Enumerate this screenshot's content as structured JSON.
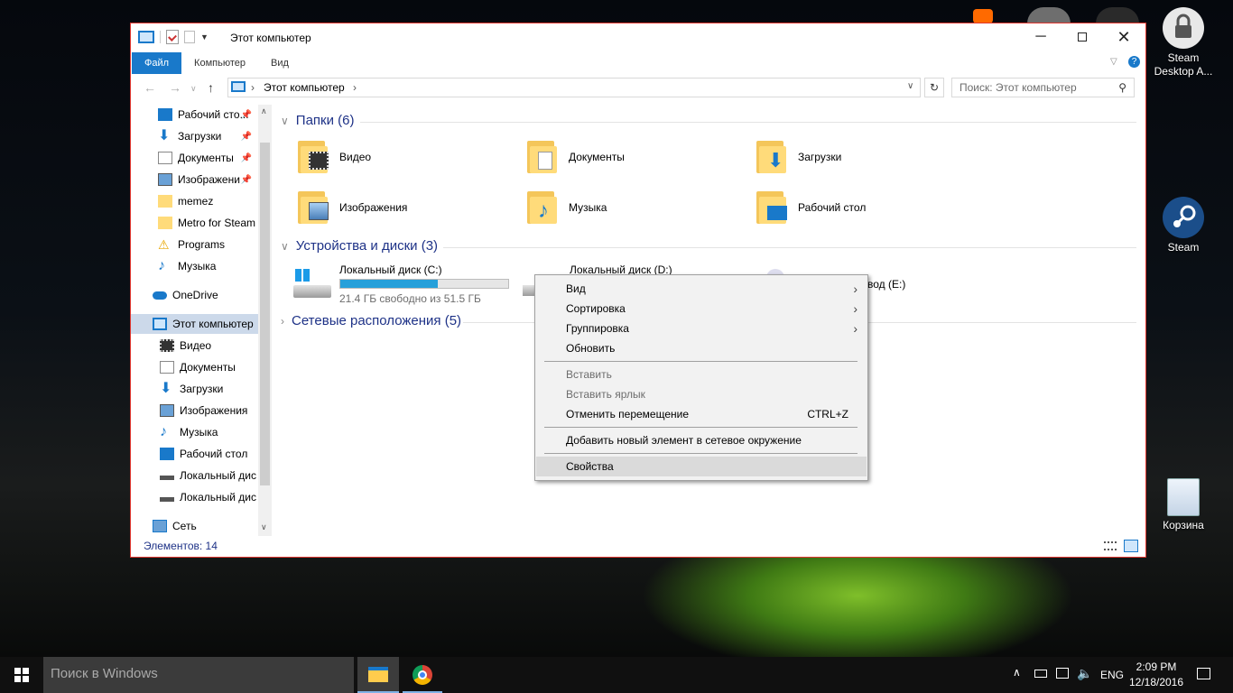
{
  "desktop": {
    "icons": [
      {
        "label": "Steam Desktop A...",
        "icon": "steam-desktop-auth-icon"
      },
      {
        "label": "Steam",
        "icon": "steam-icon"
      },
      {
        "label": "Корзина",
        "icon": "recycle-bin-icon"
      }
    ]
  },
  "window": {
    "title": "Этот компьютер",
    "tabs": [
      "Файл",
      "Компьютер",
      "Вид"
    ],
    "address": "Этот компьютер",
    "search_placeholder": "Поиск: Этот компьютер",
    "status": "Элементов: 14"
  },
  "sidebar": {
    "items": [
      {
        "label": "Рабочий сто...",
        "pinned": true
      },
      {
        "label": "Загрузки",
        "pinned": true
      },
      {
        "label": "Документы",
        "pinned": true
      },
      {
        "label": "Изображени",
        "pinned": true
      },
      {
        "label": "memez"
      },
      {
        "label": "Metro for Steam"
      },
      {
        "label": "Programs"
      },
      {
        "label": "Музыка"
      },
      {
        "label": "OneDrive"
      },
      {
        "label": "Этот компьютер"
      },
      {
        "label": "Видео"
      },
      {
        "label": "Документы"
      },
      {
        "label": "Загрузки"
      },
      {
        "label": "Изображения"
      },
      {
        "label": "Музыка"
      },
      {
        "label": "Рабочий стол"
      },
      {
        "label": "Локальный дис"
      },
      {
        "label": "Локальный дис"
      },
      {
        "label": "Сеть"
      }
    ]
  },
  "content": {
    "folders_header": "Папки (6)",
    "folders": [
      "Видео",
      "Документы",
      "Загрузки",
      "Изображения",
      "Музыка",
      "Рабочий стол"
    ],
    "devices_header": "Устройства и диски (3)",
    "drives": [
      {
        "name": "Локальный диск (C:)",
        "free": "21.4 ГБ свободно из 51.5 ГБ",
        "used_fraction": 0.58
      },
      {
        "name": "Локальный диск (D:)"
      },
      {
        "name": "вод (E:)"
      }
    ],
    "network_header": "Сетевые расположения (5)"
  },
  "context_menu": {
    "items": [
      {
        "label": "Вид",
        "submenu": true
      },
      {
        "label": "Сортировка",
        "submenu": true
      },
      {
        "label": "Группировка",
        "submenu": true
      },
      {
        "label": "Обновить"
      },
      {
        "label": "Вставить",
        "disabled": true
      },
      {
        "label": "Вставить ярлык",
        "disabled": true
      },
      {
        "label": "Отменить перемещение",
        "shortcut": "CTRL+Z"
      },
      {
        "label": "Добавить новый элемент в сетевое окружение"
      },
      {
        "label": "Свойства"
      }
    ]
  },
  "taskbar": {
    "search": "Поиск в Windows",
    "lang": "ENG",
    "time": "2:09 PM",
    "date": "12/18/2016"
  },
  "colors": {
    "accent": "#1979ca",
    "window_border": "#e0372f",
    "header": "#1e3287"
  }
}
